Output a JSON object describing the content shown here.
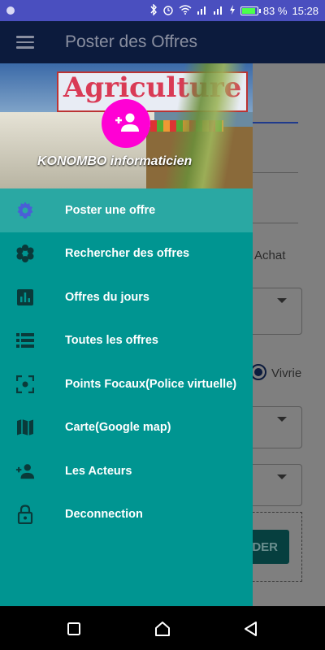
{
  "status_bar": {
    "battery_percent": "83 %",
    "battery_level": 0.83,
    "time": "15:28",
    "icons": [
      "bluetooth-icon",
      "alarm-icon",
      "wifi-icon",
      "signal-icon",
      "signal-icon",
      "charging-icon",
      "battery-icon"
    ]
  },
  "app_bar": {
    "title": "Poster des Offres",
    "menu_icon": "hamburger-icon"
  },
  "background": {
    "radio_achat": "Achat",
    "radio_vivrier": "Vivrie",
    "button_partial": "DER"
  },
  "drawer": {
    "header": {
      "banner_text": "Agriculture",
      "user_name": "KONOMBO informaticien",
      "avatar_icon": "add-person-icon",
      "avatar_color": "#ff00d4"
    },
    "items": [
      {
        "label": "Poster une offre",
        "icon": "settings-gear-icon",
        "active": true
      },
      {
        "label": "Rechercher des offres",
        "icon": "flower-icon",
        "active": false
      },
      {
        "label": "Offres du jours",
        "icon": "bar-chart-icon",
        "active": false
      },
      {
        "label": "Toutes les offres",
        "icon": "list-icon",
        "active": false
      },
      {
        "label": "Points Focaux(Police virtuelle)",
        "icon": "center-focus-icon",
        "active": false
      },
      {
        "label": "Carte(Google map)",
        "icon": "map-icon",
        "active": false
      },
      {
        "label": "Les Acteurs",
        "icon": "person-add-icon",
        "active": false
      },
      {
        "label": "Deconnection",
        "icon": "lock-icon",
        "active": false
      }
    ]
  },
  "colors": {
    "status_bar": "#4a4fbf",
    "app_bar": "#0c1b3d",
    "drawer": "#009591",
    "drawer_active": "#2aa8a3",
    "icon_active": "#4a5fd6",
    "icon_default": "#0a3a3a"
  },
  "nav_bar": {
    "buttons": [
      "recents-icon",
      "home-icon",
      "back-icon"
    ]
  }
}
